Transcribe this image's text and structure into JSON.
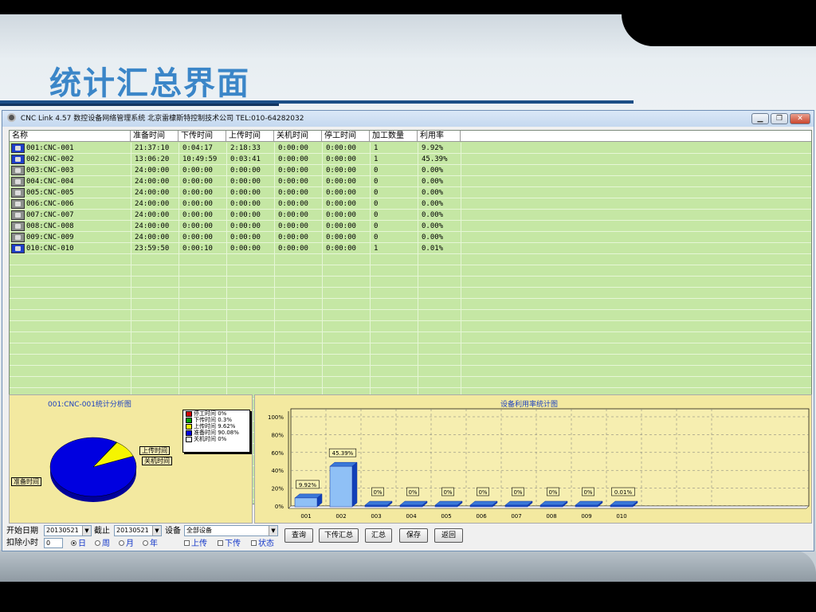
{
  "slide": {
    "title": "统计汇总界面"
  },
  "window": {
    "title": "CNC Link 4.57 数控设备网络管理系统   北京雷棣斯特控制技术公司   TEL:010-64282032",
    "controls": [
      "▁",
      "❐",
      "✕"
    ]
  },
  "table": {
    "columns": [
      "名称",
      "准备时间",
      "下传时间",
      "上传时间",
      "关机时间",
      "停工时间",
      "加工数量",
      "利用率"
    ],
    "rows": [
      {
        "name": "001:CNC-001",
        "prep": "21:37:10",
        "down": "0:04:17",
        "up": "2:18:33",
        "off": "0:00:00",
        "stop": "0:00:00",
        "count": "1",
        "util": "9.92%",
        "icon": "on"
      },
      {
        "name": "002:CNC-002",
        "prep": "13:06:20",
        "down": "10:49:59",
        "up": "0:03:41",
        "off": "0:00:00",
        "stop": "0:00:00",
        "count": "1",
        "util": "45.39%",
        "icon": "on"
      },
      {
        "name": "003:CNC-003",
        "prep": "24:00:00",
        "down": "0:00:00",
        "up": "0:00:00",
        "off": "0:00:00",
        "stop": "0:00:00",
        "count": "0",
        "util": "0.00%",
        "icon": "off"
      },
      {
        "name": "004:CNC-004",
        "prep": "24:00:00",
        "down": "0:00:00",
        "up": "0:00:00",
        "off": "0:00:00",
        "stop": "0:00:00",
        "count": "0",
        "util": "0.00%",
        "icon": "off"
      },
      {
        "name": "005:CNC-005",
        "prep": "24:00:00",
        "down": "0:00:00",
        "up": "0:00:00",
        "off": "0:00:00",
        "stop": "0:00:00",
        "count": "0",
        "util": "0.00%",
        "icon": "off"
      },
      {
        "name": "006:CNC-006",
        "prep": "24:00:00",
        "down": "0:00:00",
        "up": "0:00:00",
        "off": "0:00:00",
        "stop": "0:00:00",
        "count": "0",
        "util": "0.00%",
        "icon": "off"
      },
      {
        "name": "007:CNC-007",
        "prep": "24:00:00",
        "down": "0:00:00",
        "up": "0:00:00",
        "off": "0:00:00",
        "stop": "0:00:00",
        "count": "0",
        "util": "0.00%",
        "icon": "off"
      },
      {
        "name": "008:CNC-008",
        "prep": "24:00:00",
        "down": "0:00:00",
        "up": "0:00:00",
        "off": "0:00:00",
        "stop": "0:00:00",
        "count": "0",
        "util": "0.00%",
        "icon": "off"
      },
      {
        "name": "009:CNC-009",
        "prep": "24:00:00",
        "down": "0:00:00",
        "up": "0:00:00",
        "off": "0:00:00",
        "stop": "0:00:00",
        "count": "0",
        "util": "0.00%",
        "icon": "off"
      },
      {
        "name": "010:CNC-010",
        "prep": "23:59:50",
        "down": "0:00:10",
        "up": "0:00:00",
        "off": "0:00:00",
        "stop": "0:00:00",
        "count": "1",
        "util": "0.01%",
        "icon": "on"
      }
    ]
  },
  "chart_data": [
    {
      "type": "pie",
      "title": "001:CNC-001统计分析图",
      "categories": [
        "停工时间",
        "下传时间",
        "上传时间",
        "准备时间",
        "关机时间"
      ],
      "values": [
        0,
        0.3,
        9.62,
        90.08,
        0
      ],
      "legend": [
        "停工时间 0%",
        "下传时间 0.3%",
        "上传时间 9.62%",
        "准备时间 90.08%",
        "关机时间 0%"
      ],
      "colors": [
        "#d40000",
        "#00a000",
        "#f5f500",
        "#0000e0",
        "#ffffff"
      ],
      "slice_labels": [
        "上传时间",
        "关机时间",
        "准备时间"
      ],
      "legend_position": "top-right"
    },
    {
      "type": "bar",
      "title": "设备利用率统计图",
      "categories": [
        "001",
        "002",
        "003",
        "004",
        "005",
        "006",
        "007",
        "008",
        "009",
        "010"
      ],
      "values": [
        9.92,
        45.39,
        0,
        0,
        0,
        0,
        0,
        0,
        0,
        0.01
      ],
      "data_labels": [
        "9.92%",
        "45.39%",
        "0%",
        "0%",
        "0%",
        "0%",
        "0%",
        "0%",
        "0%",
        "0.01%"
      ],
      "yticks": [
        "0%",
        "20%",
        "40%",
        "60%",
        "80%",
        "100%"
      ],
      "ylim": [
        0,
        100
      ],
      "grid": true,
      "bar_color": "#1f6fe0"
    }
  ],
  "controls": {
    "start_label": "开始日期",
    "start_value": "20130521",
    "end_label": "截止",
    "end_value": "20130521",
    "device_label": "设备",
    "device_value": "全部设备",
    "deduct_label": "扣除小时",
    "deduct_value": "0",
    "period": [
      "日",
      "周",
      "月",
      "年"
    ],
    "checks": [
      "上传",
      "下传",
      "状态"
    ],
    "buttons": [
      "查询",
      "下传汇总",
      "汇总",
      "保存",
      "返回"
    ]
  }
}
